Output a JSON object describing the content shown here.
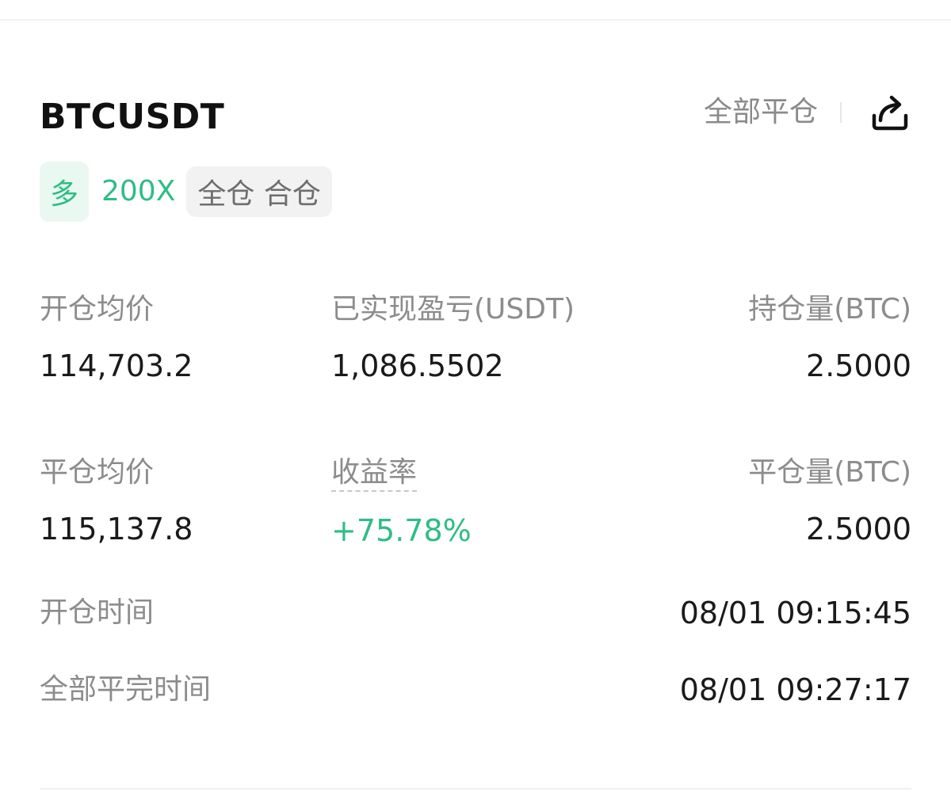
{
  "position": {
    "symbol": "BTCUSDT",
    "close_all_label": "全部平仓",
    "share_icon": "share-icon",
    "side": "多",
    "leverage": "200X",
    "margin_mode": "全仓 合仓"
  },
  "stats": {
    "open_avg_label": "开仓均价",
    "open_avg_value": "114,703.2",
    "realized_pnl_label": "已实现盈亏(USDT)",
    "realized_pnl_value": "1,086.5502",
    "position_size_label": "持仓量(BTC)",
    "position_size_value": "2.5000",
    "close_avg_label": "平仓均价",
    "close_avg_value": "115,137.8",
    "roi_label": "收益率",
    "roi_value": "+75.78%",
    "close_size_label": "平仓量(BTC)",
    "close_size_value": "2.5000",
    "open_time_label": "开仓时间",
    "open_time_value": "08/01 09:15:45",
    "close_time_label": "全部平完时间",
    "close_time_value": "08/01 09:27:17"
  },
  "colors": {
    "profit_green": "#2ebd85",
    "label_gray": "#8c8c8c",
    "text_dark": "#1a1a1a"
  }
}
